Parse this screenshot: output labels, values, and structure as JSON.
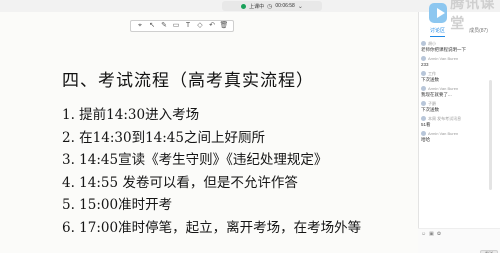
{
  "topbar": {
    "label": "上课中",
    "time": "00:06:58"
  },
  "slide": {
    "title": "四、考试流程（高考真实流程）",
    "lines": [
      "1. 提前14:30进入考场",
      "2. 在14:30到14:45之间上好厕所",
      "3. 14:45宣读《考生守则》《违纪处理规定》",
      "4. 14:55 发卷可以看，但是不允许作答",
      "5. 15:00准时开考",
      "6. 17:00准时停笔，起立，离开考场，在考场外等"
    ]
  },
  "toolbar": {
    "tools": [
      "⌖",
      "↖",
      "✎",
      "▭",
      "T",
      "◇",
      "↶",
      "🗑"
    ]
  },
  "panel": {
    "brand": "腾讯课堂",
    "tabs": [
      "讨论区",
      "成员(87)"
    ],
    "messages": [
      {
        "user": "胡小",
        "text": "老师你把课程说明一下"
      },
      {
        "user": "Armin Van Buren",
        "text": "233"
      },
      {
        "user": "工作",
        "text": "下次送数"
      },
      {
        "user": "Armin Van Buren",
        "text": "我现在就要了..."
      },
      {
        "user": "子爵",
        "text": "下次送数"
      },
      {
        "user": "本周 发布考试讯息",
        "text": "51看"
      },
      {
        "user": "Armin Van Buren",
        "text": "哈哈"
      }
    ],
    "send_label": "发送"
  }
}
